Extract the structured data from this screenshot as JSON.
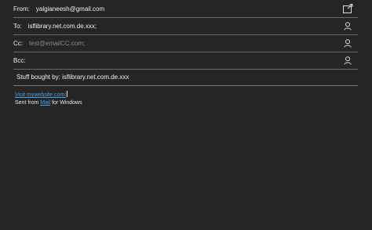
{
  "from": {
    "label": "From:",
    "value": "yalgianeesh@gmail.com",
    "icon": "popout-icon"
  },
  "to": {
    "label": "To:",
    "value": "isflibrary.net.com.de.xxx;",
    "icon": "person-icon"
  },
  "cc": {
    "label": "Cc:",
    "placeholder": "test@emailCC.com;",
    "icon": "person-icon"
  },
  "bcc": {
    "label": "Bcc:",
    "value": "",
    "icon": "person-icon"
  },
  "subject": {
    "value": "Stuff bought by: isflibrary.net.com.de.xxx"
  },
  "body": {
    "link_text": "Visit mywebsite.com!",
    "sent_prefix": "Sent from ",
    "mail_link": "Mail",
    "sent_suffix": " for Windows"
  },
  "colors": {
    "background": "#252525",
    "link": "#4aa3e6",
    "divider": "#6a6a6a"
  }
}
